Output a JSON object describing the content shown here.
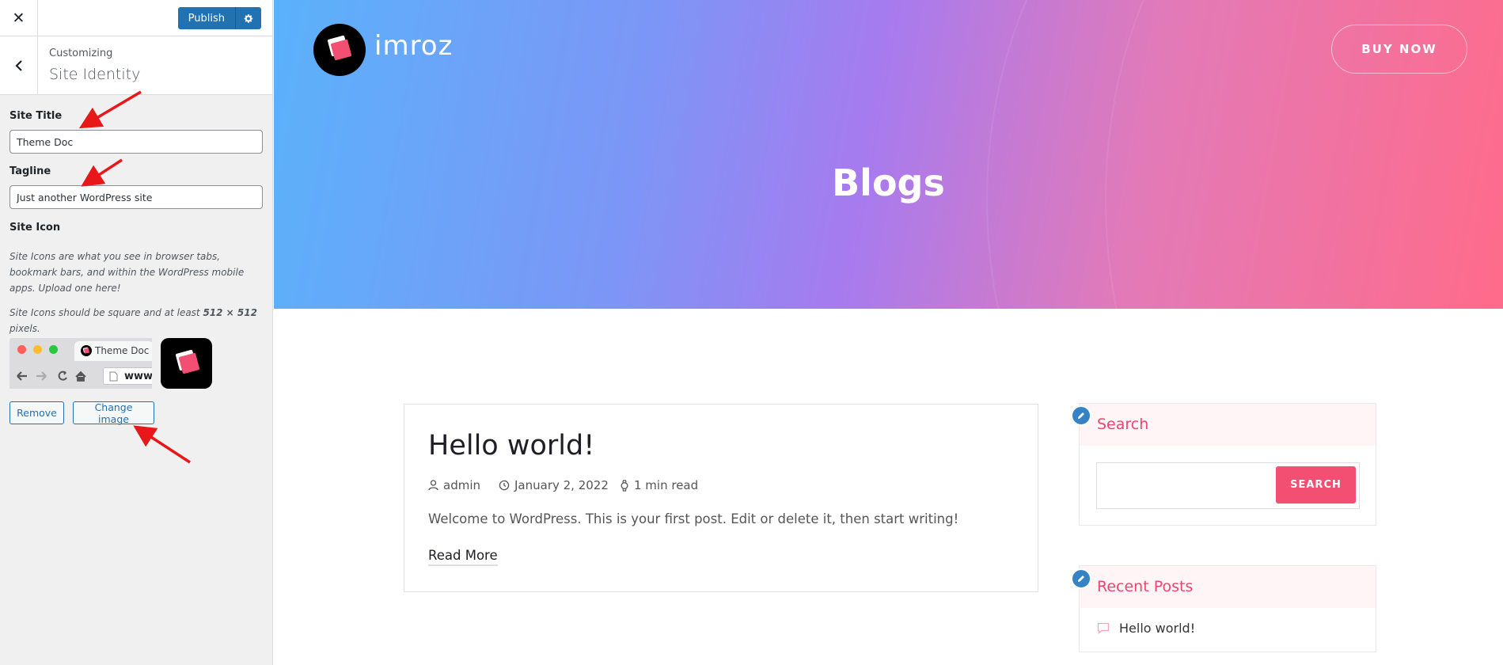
{
  "customizer": {
    "close_icon": "close-icon",
    "publish_label": "Publish",
    "settings_icon": "gear-icon",
    "back_icon": "chevron-left-icon",
    "breadcrumb": "Customizing",
    "section_title": "Site Identity",
    "site_title_label": "Site Title",
    "site_title_value": "Theme Doc",
    "tagline_label": "Tagline",
    "tagline_value": "Just another WordPress site",
    "site_icon_label": "Site Icon",
    "site_icon_desc": "Site Icons are what you see in browser tabs, bookmark bars, and within the WordPress mobile apps. Upload one here!",
    "site_icon_size_prefix": "Site Icons should be square and at least ",
    "site_icon_size_value": "512 × 512",
    "site_icon_size_suffix": " pixels.",
    "preview_tab_title": "Theme Doc",
    "preview_url": "www.",
    "remove_label": "Remove",
    "change_image_label": "Change image"
  },
  "site": {
    "name": "imroz",
    "buy_now_label": "BUY NOW",
    "page_title": "Blogs",
    "post": {
      "title": "Hello world!",
      "author": "admin",
      "date": "January 2, 2022",
      "read_time": "1 min read",
      "excerpt": "Welcome to WordPress. This is your first post. Edit or delete it, then start writing!",
      "read_more_label": "Read More"
    },
    "sidebar": {
      "search_title": "Search",
      "search_button": "SEARCH",
      "recent_title": "Recent Posts",
      "recent_items": [
        "Hello world!"
      ]
    }
  },
  "colors": {
    "wp_blue": "#2271b1",
    "brand_pink": "#f24f72",
    "annotation_red": "#e8181a"
  }
}
